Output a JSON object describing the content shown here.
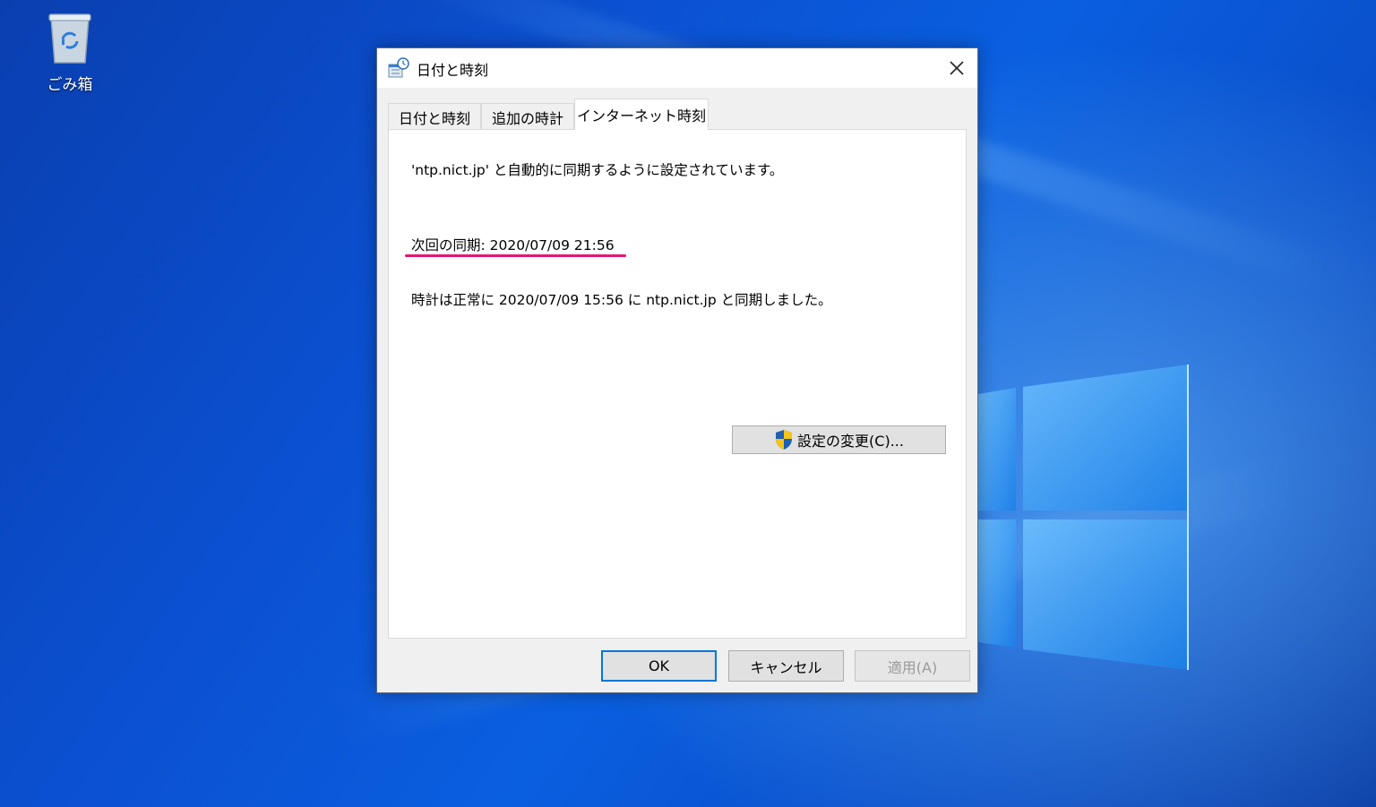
{
  "desktop": {
    "recycle_bin_label": "ごみ箱"
  },
  "dialog": {
    "title": "日付と時刻",
    "tabs": [
      {
        "label": "日付と時刻"
      },
      {
        "label": "追加の時計"
      },
      {
        "label": "インターネット時刻"
      }
    ],
    "active_tab": "インターネット時刻",
    "panel": {
      "sync_status": "'ntp.nict.jp' と自動的に同期するように設定されています。",
      "next_sync": "次回の同期: 2020/07/09 21:56",
      "last_sync": "時計は正常に 2020/07/09 15:56 に ntp.nict.jp と同期しました。",
      "change_settings_label": "設定の変更(C)..."
    },
    "buttons": {
      "ok": "OK",
      "cancel": "キャンセル",
      "apply": "適用(A)"
    }
  },
  "colors": {
    "highlight_underline": "#e4176d",
    "default_button_border": "#0078d7"
  },
  "icons": {
    "close": "close-icon",
    "app": "date-time-icon",
    "uac": "uac-shield-icon",
    "recycle_bin": "recycle-bin-icon"
  }
}
